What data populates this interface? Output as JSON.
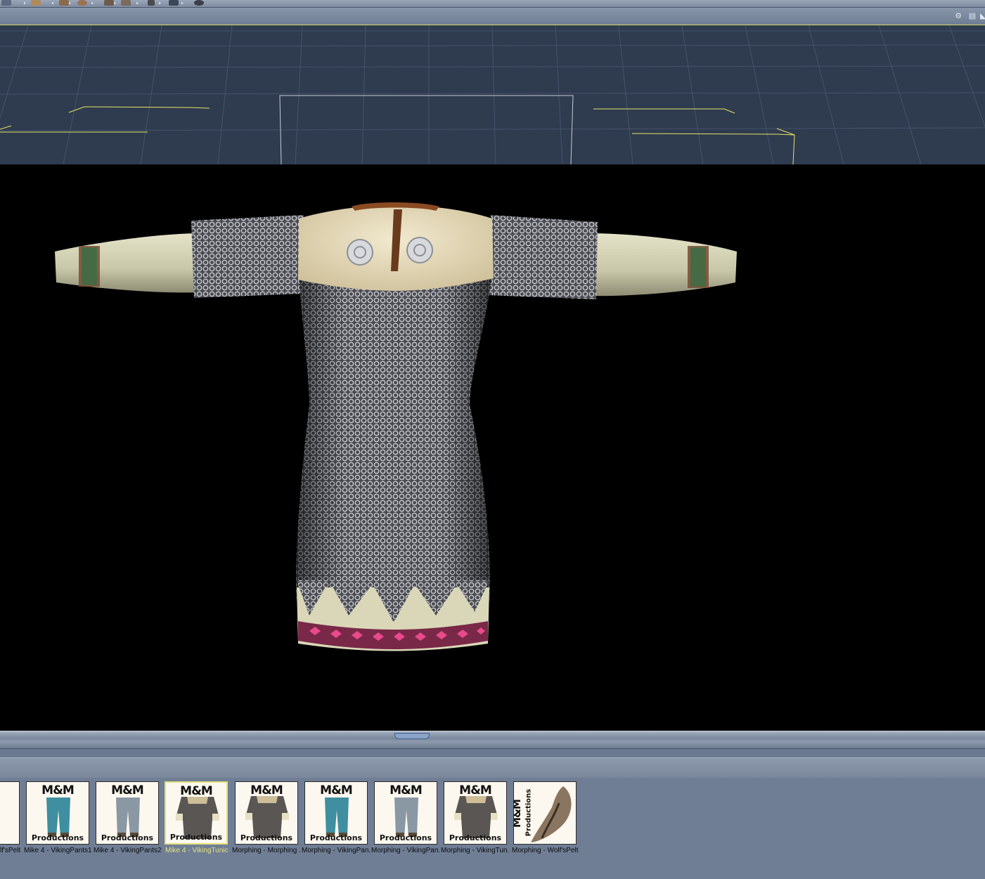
{
  "colors": {
    "viewport_bg": "#000000",
    "grid_bg": "#2f3b4f",
    "grid_line": "#45526a",
    "wire": "#e6e664",
    "panel": "#6f7e95",
    "selected_label": "#e6e27a"
  },
  "toolbar": {
    "icons": [
      "figure-icon",
      "props-icon",
      "hair-icon",
      "hand-icon",
      "lights-icon",
      "camera-icon",
      "materials-icon",
      "poses-icon",
      "scenes-icon"
    ]
  },
  "doc_window": {
    "icons": [
      "render-settings-icon",
      "window-layout-icon",
      "options-icon"
    ]
  },
  "library": {
    "items": [
      {
        "label": "lf'sPelt",
        "kind": "pelt-partial",
        "selected": false
      },
      {
        "label": "Mike 4 - VikingPants1",
        "kind": "pants-blue",
        "selected": false
      },
      {
        "label": "Mike 4 - VikingPants2",
        "kind": "pants-grey",
        "selected": false
      },
      {
        "label": "Mike 4 - VikingTunic",
        "kind": "tunic",
        "selected": true
      },
      {
        "label": "Morphing - Morphing .",
        "kind": "tunic",
        "selected": false
      },
      {
        "label": "Morphing - VikingPan.",
        "kind": "pants-blue",
        "selected": false
      },
      {
        "label": "Morphing - VikingPan.",
        "kind": "pants-grey",
        "selected": false
      },
      {
        "label": "Morphing - VikingTun.",
        "kind": "tunic",
        "selected": false
      },
      {
        "label": "Morphing - Wolf'sPelt",
        "kind": "pelt",
        "selected": false
      }
    ],
    "thumb_brand_top": "M&M",
    "thumb_brand_bottom": "Productions"
  }
}
